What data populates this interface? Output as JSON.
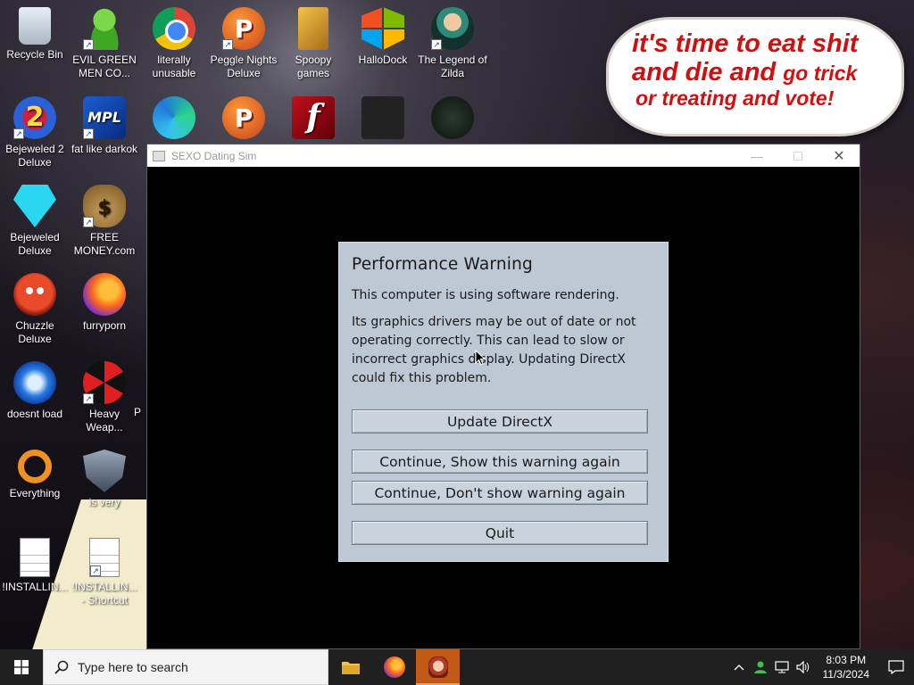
{
  "desktop": {
    "icons": [
      {
        "label": "Recycle Bin",
        "icon": "recycle-bin-icon"
      },
      {
        "label": "EVIL GREEN MEN CO...",
        "icon": "green-men-icon"
      },
      {
        "label": "literally unusable",
        "icon": "chrome-icon"
      },
      {
        "label": "Peggle Nights Deluxe",
        "icon": "peggle-icon"
      },
      {
        "label": "Spoopy games",
        "icon": "folder-games-icon"
      },
      {
        "label": "HalloDock",
        "icon": "windows-icon"
      },
      {
        "label": "The Legend of Zilda",
        "icon": "zilda-icon"
      },
      {
        "label": "Bejeweled 2 Deluxe",
        "icon": "bejeweled2-icon"
      },
      {
        "label": "fat like darkok",
        "icon": "mpl-icon"
      },
      {
        "label": "Bejeweled Deluxe",
        "icon": "diamond-icon"
      },
      {
        "label": "FREE MONEY.com",
        "icon": "money-bag-icon"
      },
      {
        "label": "Chuzzle Deluxe",
        "icon": "chuzzle-icon"
      },
      {
        "label": "furryporn",
        "icon": "firefox-icon"
      },
      {
        "label": "doesnt load",
        "icon": "thunderbird-icon"
      },
      {
        "label": "Heavy Weap...",
        "icon": "radiation-icon"
      },
      {
        "label": "P",
        "icon": ""
      },
      {
        "label": "Everything",
        "icon": "everything-icon"
      },
      {
        "label": "is very",
        "icon": "shield-icon"
      },
      {
        "label": "!INSTALLIN...",
        "icon": "document-icon"
      },
      {
        "label": "!INSTALLIN... - Shortcut",
        "icon": "document-icon"
      },
      {
        "label": "",
        "icon": "edge-icon"
      },
      {
        "label": "",
        "icon": "peggle-icon"
      },
      {
        "label": "",
        "icon": "flash-icon"
      },
      {
        "label": "",
        "icon": "remote-desktop-icon"
      },
      {
        "label": "",
        "icon": "yashma-icon"
      }
    ],
    "bubble": {
      "line1": "it's time to eat shit",
      "line2_big": "and die and",
      "line2_small": "go trick",
      "line3": "or treating and vote!"
    }
  },
  "window": {
    "title": "SEXO Dating Sim",
    "dialog": {
      "heading": "Performance Warning",
      "message1": "This computer is using software rendering.",
      "message2": "Its graphics drivers may be out of date or not operating correctly. This can lead to slow or incorrect graphics display. Updating DirectX could fix this problem.",
      "buttons": {
        "update": "Update DirectX",
        "continue_show": "Continue, Show this warning again",
        "continue_dont": "Continue, Don't show warning again",
        "quit": "Quit"
      }
    }
  },
  "taskbar": {
    "search_placeholder": "Type here to search",
    "time": "8:03 PM",
    "date": "11/3/2024",
    "accent": "#c05a14"
  }
}
